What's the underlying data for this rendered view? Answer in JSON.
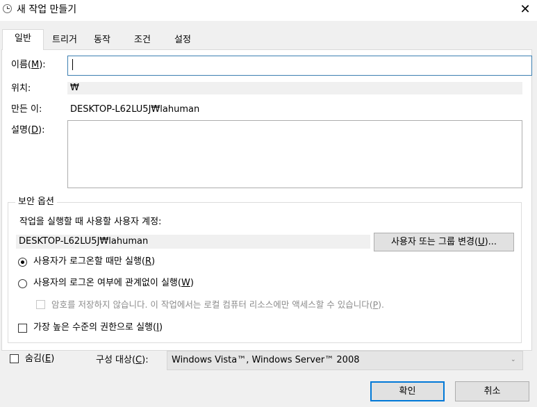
{
  "window": {
    "title": "새 작업 만들기",
    "close_glyph": "✕",
    "icon": "clock-icon"
  },
  "tabs": [
    {
      "label": "일반",
      "active": true
    },
    {
      "label": "트리거",
      "active": false
    },
    {
      "label": "동작",
      "active": false
    },
    {
      "label": "조건",
      "active": false
    },
    {
      "label": "설정",
      "active": false
    }
  ],
  "general": {
    "name_label_pre": "이름(",
    "name_label_key": "M",
    "name_label_post": "):",
    "name_value": "",
    "location_label": "위치:",
    "location_value": "₩",
    "author_label": "만든 이:",
    "author_value": "DESKTOP-L62LU5J₩lahuman",
    "desc_label_pre": "설명(",
    "desc_label_key": "D",
    "desc_label_post": "):",
    "desc_value": ""
  },
  "security": {
    "group_title": "보안 옵션",
    "account_prompt": "작업을 실행할 때 사용할 사용자 계정:",
    "account_value": "DESKTOP-L62LU5J₩lahuman",
    "change_button_pre": "사용자 또는 그룹 변경(",
    "change_button_key": "U",
    "change_button_post": ")...",
    "radio_logged_on_pre": "사용자가 로그온할 때만 실행(",
    "radio_logged_on_key": "R",
    "radio_logged_on_post": ")",
    "radio_whether_pre": "사용자의 로그온 여부에 관계없이 실행(",
    "radio_whether_key": "W",
    "radio_whether_post": ")",
    "no_password_pre": "암호를 저장하지 않습니다. 이 작업에서는 로컬 컴퓨터 리소스에만 액세스할 수 있습니다(",
    "no_password_key": "P",
    "no_password_post": ").",
    "highest_priv_pre": "가장 높은 수준의 권한으로 실행(",
    "highest_priv_key": "I",
    "highest_priv_post": ")",
    "selected_radio": "logged_on"
  },
  "footer": {
    "hidden_pre": "숨김(",
    "hidden_key": "E",
    "hidden_post": ")",
    "configure_pre": "구성 대상(",
    "configure_key": "C",
    "configure_post": "):",
    "configure_value": "Windows Vista™, Windows Server™ 2008",
    "ok_label": "확인",
    "cancel_label": "취소"
  }
}
